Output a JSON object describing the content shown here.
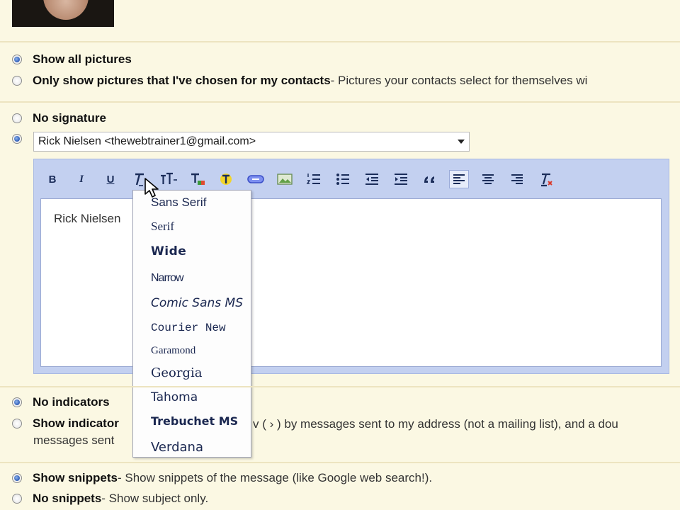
{
  "pictures": {
    "show_all_label": "Show all pictures",
    "only_chosen_label": "Only show pictures that I've chosen for my contacts",
    "only_chosen_desc": " - Pictures your contacts select for themselves wi"
  },
  "signature": {
    "none_label": "No signature",
    "selected_identity": "Rick Nielsen <thewebtrainer1@gmail.com>",
    "body_text": "Rick Nielsen"
  },
  "toolbar": {
    "bold": "B",
    "italic": "I",
    "underline": "U"
  },
  "font_menu": {
    "items": [
      "Sans Serif",
      "Serif",
      "Wide",
      "Narrow",
      "Comic Sans MS",
      "Courier New",
      "Garamond",
      "Georgia",
      "Tahoma",
      "Trebuchet MS",
      "Verdana"
    ]
  },
  "indicators": {
    "none_label": "No indicators",
    "show_label": "Show indicator",
    "show_desc": "v ( › ) by messages sent to my address (not a mailing list), and a dou",
    "show_desc_line2": "messages sent"
  },
  "snippets": {
    "show_label": "Show snippets",
    "show_desc": " - Show snippets of the message (like Google web search!).",
    "none_label": "No snippets",
    "none_desc": " - Show subject only."
  },
  "colors": {
    "page_bg": "#fbf8e3",
    "editor_frame": "#c3d0f0",
    "radio_selected": "#3a68bf"
  }
}
